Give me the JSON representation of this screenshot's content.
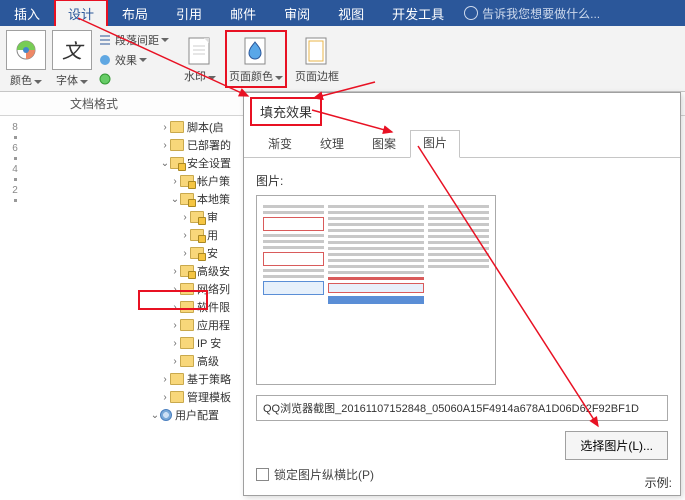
{
  "ribbon": {
    "tabs": [
      "插入",
      "设计",
      "布局",
      "引用",
      "邮件",
      "审阅",
      "视图",
      "开发工具"
    ],
    "active_tab_index": 1,
    "tell_me": "告诉我您想要做什么...",
    "groups": {
      "color_label": "颜色",
      "font_label": "字体",
      "para_spacing": "段落间距",
      "effects": "效果",
      "watermark": "水印",
      "page_color": "页面颜色",
      "page_border": "页面边框"
    }
  },
  "status_bar": {
    "label": "文档格式"
  },
  "ruler": {
    "marks": [
      "8",
      "6",
      "4",
      "2"
    ]
  },
  "tree": {
    "items": [
      {
        "indent": 1,
        "toggle": ">",
        "icon": "folder",
        "label": "脚本(启"
      },
      {
        "indent": 1,
        "toggle": ">",
        "icon": "folder",
        "label": "已部署的"
      },
      {
        "indent": 1,
        "toggle": "v",
        "icon": "folder-locked",
        "label": "安全设置"
      },
      {
        "indent": 2,
        "toggle": ">",
        "icon": "folder-locked",
        "label": "帐户策"
      },
      {
        "indent": 2,
        "toggle": "v",
        "icon": "folder-locked",
        "label": "本地策"
      },
      {
        "indent": 3,
        "toggle": ">",
        "icon": "folder-locked",
        "label": "审"
      },
      {
        "indent": 3,
        "toggle": ">",
        "icon": "folder-locked",
        "label": "用"
      },
      {
        "indent": 3,
        "toggle": ">",
        "icon": "folder-locked",
        "label": "安"
      },
      {
        "indent": 2,
        "toggle": ">",
        "icon": "folder-locked",
        "label": "高级安"
      },
      {
        "indent": 2,
        "toggle": ">",
        "icon": "folder",
        "label": "网络列"
      },
      {
        "indent": 2,
        "toggle": ">",
        "icon": "folder",
        "label": "软件限"
      },
      {
        "indent": 2,
        "toggle": ">",
        "icon": "folder",
        "label": "应用程"
      },
      {
        "indent": 2,
        "toggle": ">",
        "icon": "folder",
        "label": "IP 安"
      },
      {
        "indent": 2,
        "toggle": ">",
        "icon": "folder",
        "label": "高级"
      },
      {
        "indent": 1,
        "toggle": ">",
        "icon": "folder",
        "label": "基于策略"
      },
      {
        "indent": 1,
        "toggle": ">",
        "icon": "folder",
        "label": "管理模板"
      },
      {
        "indent": 0,
        "toggle": "v",
        "icon": "gear",
        "label": "用户配置"
      }
    ]
  },
  "dialog": {
    "title": "填充效果",
    "tabs": [
      "渐变",
      "纹理",
      "图案",
      "图片"
    ],
    "active_tab_index": 3,
    "section_label": "图片:",
    "path_value": "QQ浏览器截图_20161107152848_05060A15F4914a678A1D06D62F92BF1D",
    "select_button": "选择图片(L)...",
    "lock_aspect": "锁定图片纵横比(P)",
    "legend": "示例:"
  }
}
